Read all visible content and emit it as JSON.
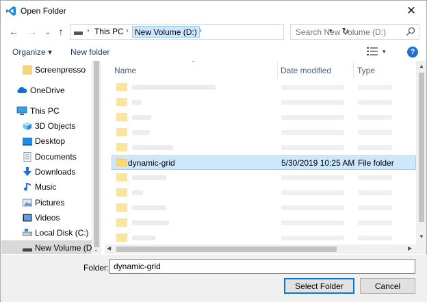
{
  "window": {
    "title": "Open Folder",
    "close_glyph": "✕",
    "app_icon": "vscode-icon"
  },
  "nav": {
    "back_glyph": "←",
    "forward_glyph": "→",
    "recent_glyph": "⌄",
    "up_glyph": "↑",
    "breadcrumb": [
      "This PC",
      "New Volume (D:)"
    ],
    "breadcrumb_sep": "›",
    "refresh_glyph": "↻",
    "dropdown_glyph": "▾",
    "search_placeholder": "Search New Volume (D:)"
  },
  "toolbar": {
    "organize_label": "Organize ▾",
    "new_folder_label": "New folder",
    "view_dropdown_glyph": "▾",
    "help_glyph": "?"
  },
  "sidebar": {
    "items": [
      {
        "label": "Screenpresso",
        "icon": "folder-icon"
      },
      {
        "label": "OneDrive",
        "icon": "cloud-icon"
      },
      {
        "label": "This PC",
        "icon": "computer-icon"
      },
      {
        "label": "3D Objects",
        "icon": "cube-icon"
      },
      {
        "label": "Desktop",
        "icon": "desktop-icon"
      },
      {
        "label": "Documents",
        "icon": "documents-icon"
      },
      {
        "label": "Downloads",
        "icon": "download-icon"
      },
      {
        "label": "Music",
        "icon": "music-icon"
      },
      {
        "label": "Pictures",
        "icon": "pictures-icon"
      },
      {
        "label": "Videos",
        "icon": "videos-icon"
      },
      {
        "label": "Local Disk (C:)",
        "icon": "drive-icon"
      },
      {
        "label": "New Volume (D:",
        "icon": "drive-icon"
      }
    ],
    "scroll_down_glyph": "⌄"
  },
  "files": {
    "columns": {
      "name": "Name",
      "date": "Date modified",
      "type": "Type"
    },
    "sort_glyph": "⌃",
    "selected": {
      "name": "dynamic-grid",
      "date": "5/30/2019 10:25 AM",
      "type": "File folder"
    },
    "scroll_up_glyph": "▲",
    "scroll_down_glyph": "▼",
    "scroll_left_glyph": "◀",
    "scroll_right_glyph": "▶"
  },
  "footer": {
    "folder_label": "Folder:",
    "folder_value": "dynamic-grid",
    "select_button": "Select Folder",
    "cancel_button": "Cancel"
  },
  "colors": {
    "selection_bg": "#cce8ff",
    "selection_border": "#99d1ff",
    "accent": "#0078d7",
    "folder_yellow": "#f8d775"
  }
}
